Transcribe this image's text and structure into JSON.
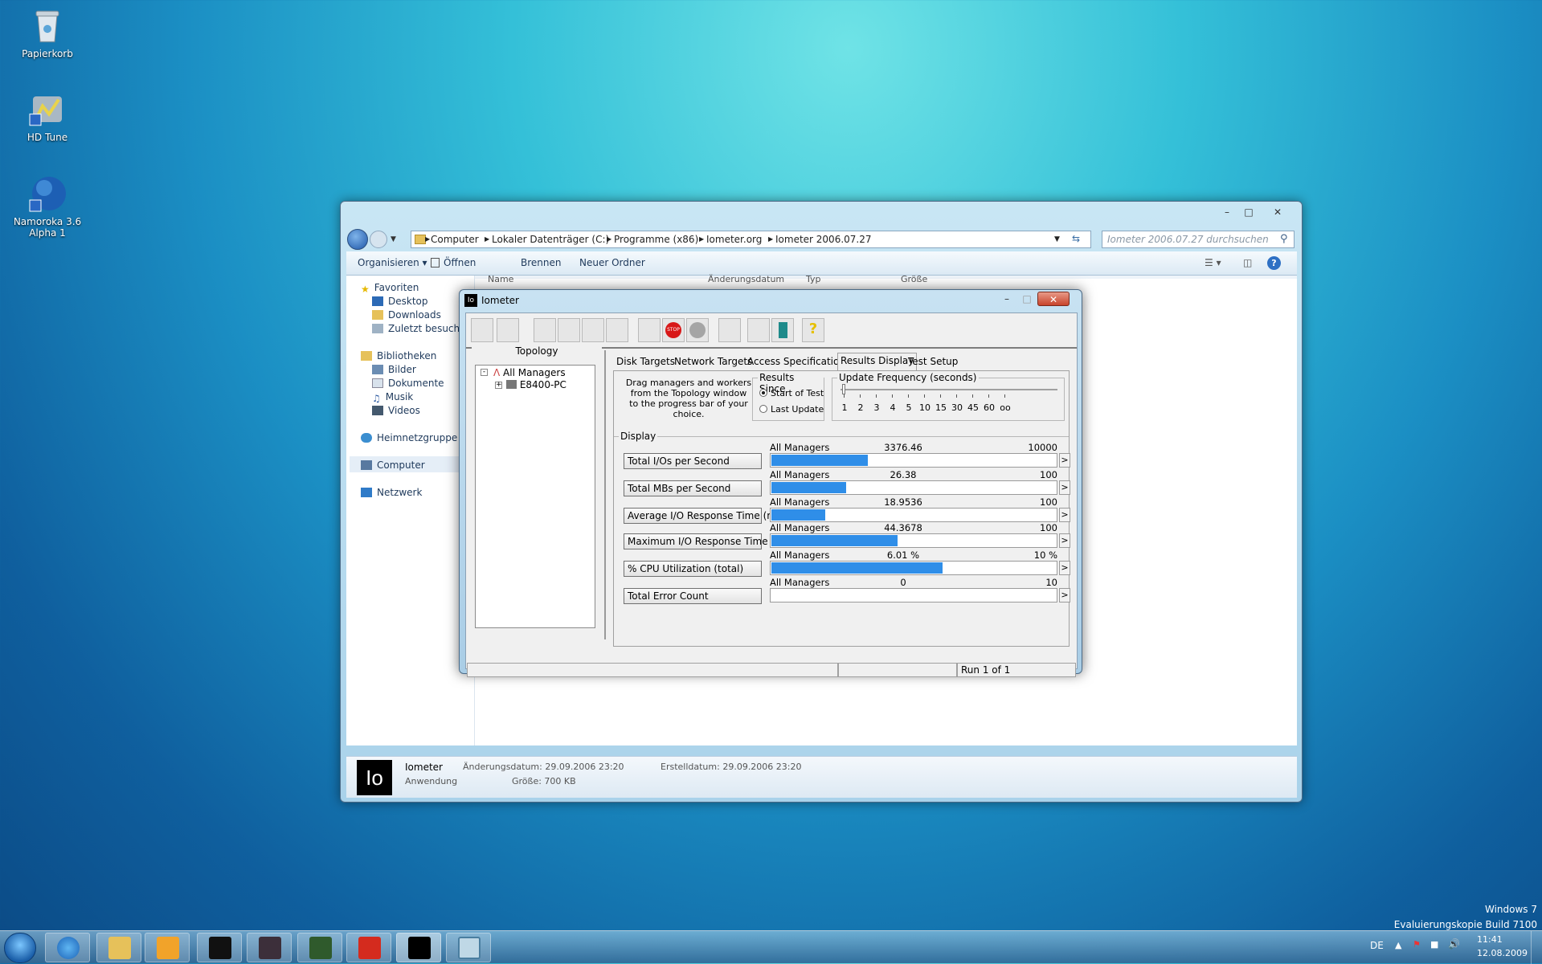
{
  "desktop": {
    "icons": [
      {
        "label": "Papierkorb"
      },
      {
        "label": "HD Tune"
      },
      {
        "label": "Namoroka 3.6 Alpha 1"
      }
    ],
    "watermark": {
      "line1": "Windows 7",
      "line2": "Evaluierungskopie Build 7100"
    }
  },
  "explorer": {
    "address": [
      "Computer",
      "Lokaler Datenträger (C:)",
      "Programme (x86)",
      "Iometer.org",
      "Iometer 2006.07.27"
    ],
    "search_placeholder": "Iometer 2006.07.27 durchsuchen",
    "toolbar": {
      "organize": "Organisieren",
      "open": "Öffnen",
      "burn": "Brennen",
      "new_folder": "Neuer Ordner"
    },
    "columns": {
      "name": "Name",
      "modified": "Änderungsdatum",
      "type": "Typ",
      "size": "Größe"
    },
    "nav": {
      "favorites": "Favoriten",
      "desktop": "Desktop",
      "downloads": "Downloads",
      "recent": "Zuletzt besucht",
      "libraries": "Bibliotheken",
      "pictures": "Bilder",
      "documents": "Dokumente",
      "music": "Musik",
      "videos": "Videos",
      "homegroup": "Heimnetzgruppe",
      "computer": "Computer",
      "network": "Netzwerk"
    },
    "details": {
      "logo": "Io",
      "name": "Iometer",
      "kind": "Anwendung",
      "modified": "Änderungsdatum: 29.09.2006 23:20",
      "created": "Erstelldatum: 29.09.2006 23:20",
      "size": "Größe: 700 KB"
    }
  },
  "iometer": {
    "title": "Iometer",
    "logo": "Io",
    "topology": {
      "title": "Topology",
      "root": "All Managers",
      "child": "E8400-PC"
    },
    "tabs": [
      "Disk Targets",
      "Network Targets",
      "Access Specifications",
      "Results Display",
      "Test Setup"
    ],
    "active_tab": "Results Display",
    "hint": [
      "Drag managers and workers",
      "from the Topology window",
      "to the progress bar of your choice."
    ],
    "results_since": {
      "legend": "Results Since",
      "opt1": "Start of Test",
      "opt2": "Last Update",
      "selected": "Start of Test"
    },
    "update_freq": {
      "legend": "Update Frequency (seconds)",
      "ticks": [
        "1",
        "2",
        "3",
        "4",
        "5",
        "10",
        "15",
        "30",
        "45",
        "60",
        "oo"
      ]
    },
    "display_legend": "Display",
    "metrics": [
      {
        "button": "Total I/Os per Second",
        "scope": "All Managers",
        "value": "3376.46",
        "max": "10000",
        "fraction": 0.3376
      },
      {
        "button": "Total MBs per Second",
        "scope": "All Managers",
        "value": "26.38",
        "max": "100",
        "fraction": 0.2638
      },
      {
        "button": "Average I/O Response Time (ms)",
        "scope": "All Managers",
        "value": "18.9536",
        "max": "100",
        "fraction": 0.1895
      },
      {
        "button": "Maximum I/O Response Time (ms)",
        "scope": "All Managers",
        "value": "44.3678",
        "max": "100",
        "fraction": 0.4437
      },
      {
        "button": "% CPU Utilization (total)",
        "scope": "All Managers",
        "value": "6.01 %",
        "max": "10 %",
        "fraction": 0.601
      },
      {
        "button": "Total Error Count",
        "scope": "All Managers",
        "value": "0",
        "max": "10",
        "fraction": 0
      }
    ],
    "status_run": "Run 1 of 1"
  },
  "taskbar": {
    "lang": "DE",
    "time": "11:41",
    "date": "12.08.2009"
  }
}
